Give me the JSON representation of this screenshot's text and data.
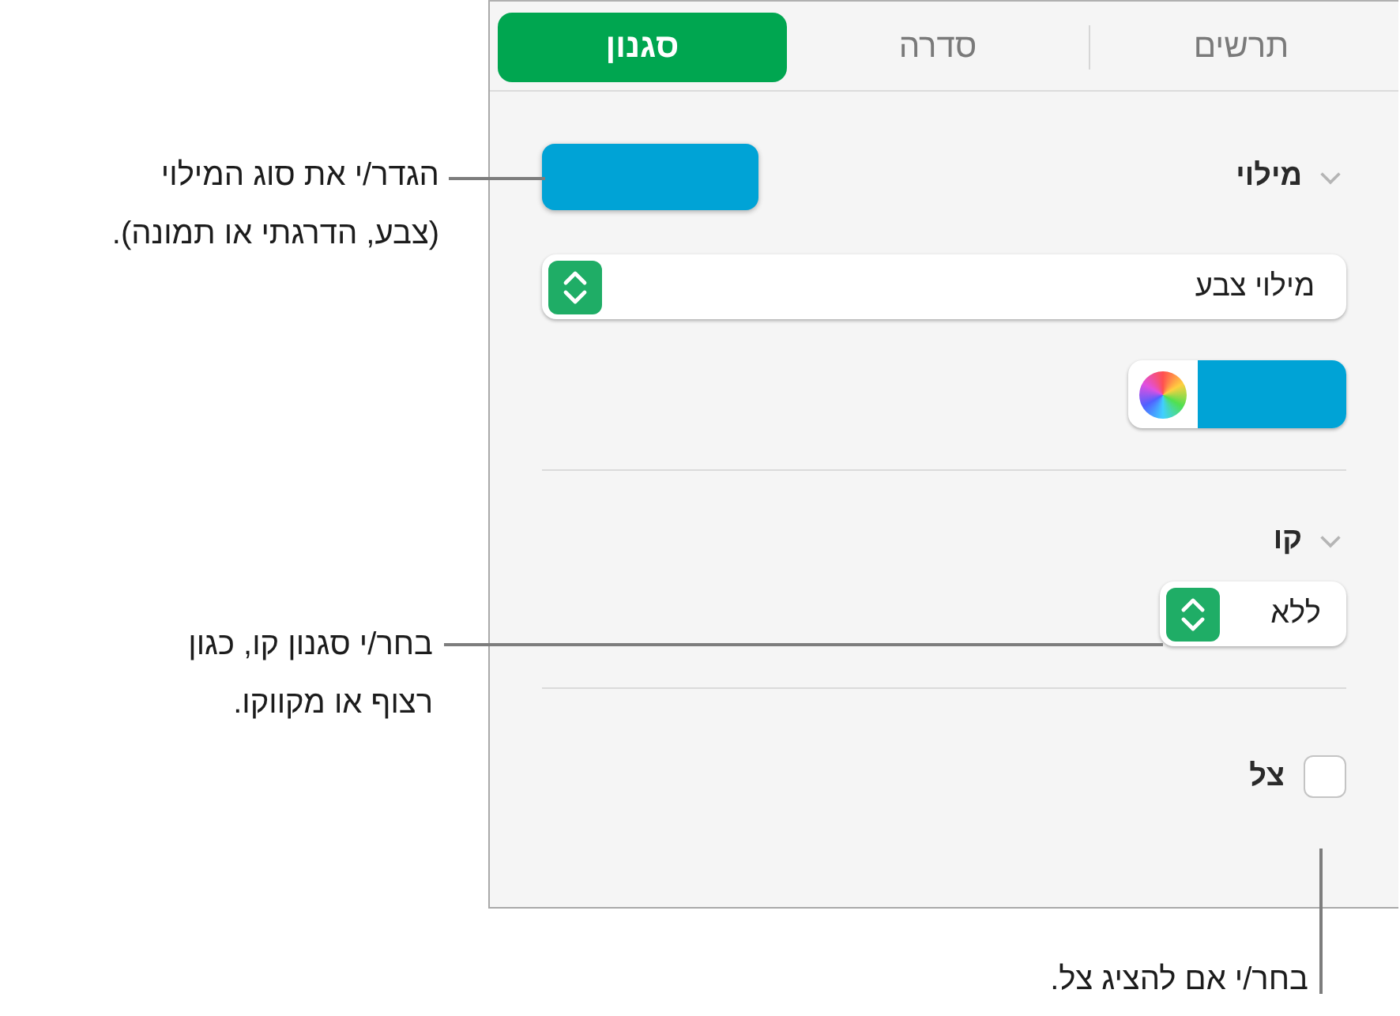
{
  "tabs": [
    {
      "label": "תרשים",
      "selected": false
    },
    {
      "label": "סדרה",
      "selected": false
    },
    {
      "label": "סגנון",
      "selected": true
    }
  ],
  "fill": {
    "label": "מילוי",
    "expanded": true,
    "popup": "מילוי צבע"
  },
  "line": {
    "label": "קו",
    "expanded": true,
    "popup": "ללא"
  },
  "shadow": {
    "label": "צל",
    "checked": false
  },
  "callouts": [
    {
      "text": "הגדר/י את סוג המילוי\n(צבע, הדרגתי או תמונה)."
    },
    {
      "text": "בחר/י סגנון קו, כגון\nרצוף או מקווקו."
    },
    {
      "text": "בחר/י אם להציג צל."
    }
  ]
}
